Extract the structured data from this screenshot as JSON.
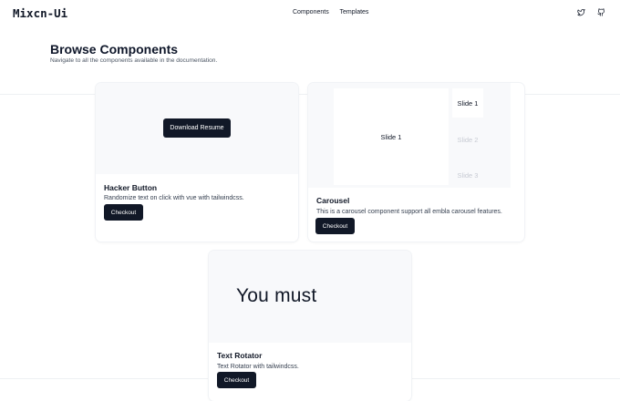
{
  "header": {
    "logo": "Mixcn-Ui",
    "nav": [
      "Components",
      "Templates"
    ],
    "icons": [
      "twitter-icon",
      "github-icon"
    ]
  },
  "hero": {
    "title": "Browse Components",
    "subtitle": "Navigate to all the components available in the documentation."
  },
  "cards": {
    "hacker": {
      "preview_button": "Download Resume",
      "title": "Hacker Button",
      "desc": "Randomize text on click with vue with tailwindcss.",
      "cta": "Checkout"
    },
    "carousel": {
      "slides": [
        "Slide 1",
        "Slide 1",
        "Slide 2",
        "Slide 3"
      ],
      "title": "Carousel",
      "desc": "This is a carousel component support all embla carousel features.",
      "cta": "Checkout"
    },
    "rotator": {
      "preview_text": "You must",
      "title": "Text Rotator",
      "desc": "Text Rotator with tailwindcss.",
      "cta": "Checkout"
    }
  },
  "colors": {
    "button_bg": "#111827",
    "preview_bg": "#f8f9fb",
    "text_primary": "#0f172a"
  }
}
